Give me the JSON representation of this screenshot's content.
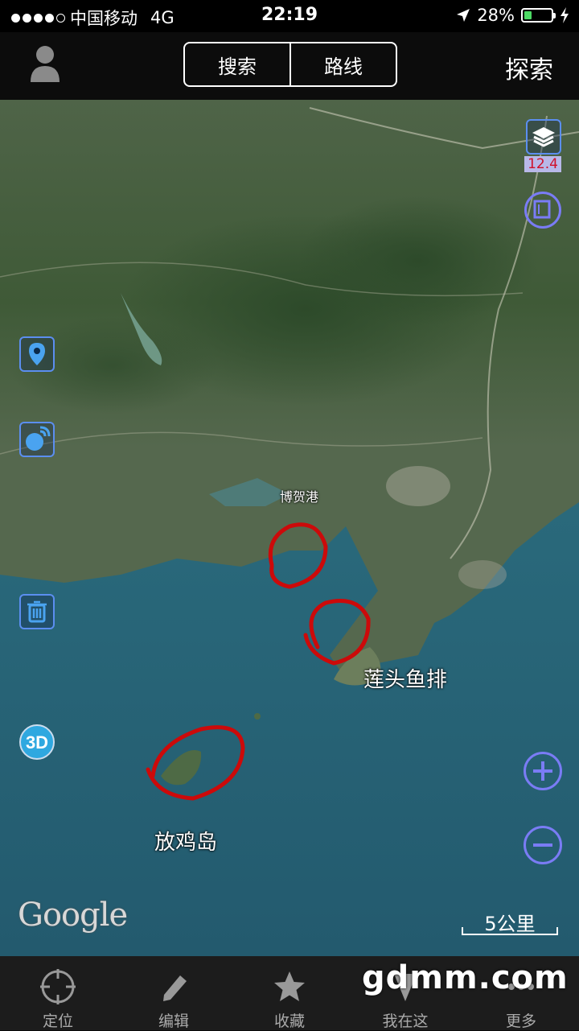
{
  "status_bar": {
    "carrier": "中国移动",
    "network": "4G",
    "time": "22:19",
    "battery_percent": "28%",
    "battery_level": 0.28,
    "signal_dots_filled": 4
  },
  "nav": {
    "segments": [
      "搜索",
      "路线"
    ],
    "explore_label": "探索"
  },
  "map": {
    "zoom_level": "12.4",
    "labels": {
      "port": "博贺港",
      "fish_raft": "莲头鱼排",
      "island": "放鸡岛"
    },
    "logo": "Google",
    "scale_label": "5公里",
    "annotation_color": "#cc0a0a"
  },
  "tabs": [
    {
      "label": "定位",
      "icon": "crosshair-icon"
    },
    {
      "label": "编辑",
      "icon": "pencil-icon"
    },
    {
      "label": "收藏",
      "icon": "star-icon"
    },
    {
      "label": "我在这",
      "icon": "location-arrow-icon"
    },
    {
      "label": "更多",
      "icon": "more-icon"
    }
  ],
  "watermark": "gdmm.com",
  "colors": {
    "control_blue": "#5b8ef0",
    "zoom_circle": "#7a7cf5",
    "battery_green": "#4cd964"
  }
}
